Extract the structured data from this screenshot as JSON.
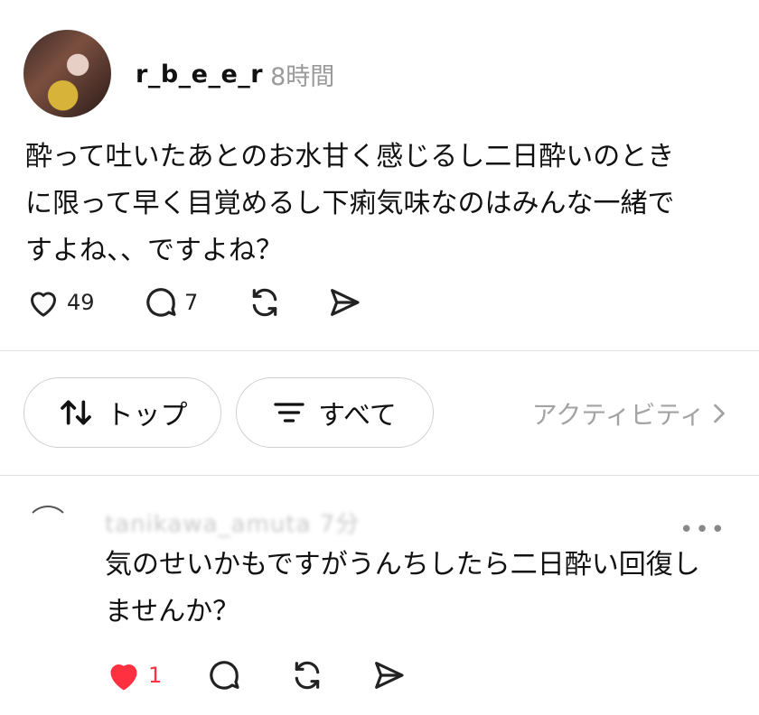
{
  "post": {
    "username": "r_b_e_e_r",
    "time": "8時間",
    "body_lines": [
      "酔って吐いたあとのお水甘く感じるし二日酔いのとき",
      "に限って早く目覚めるし下痢気味なのはみんな一緒で",
      "すよね、、ですよね？"
    ],
    "likes": "49",
    "comments": "7"
  },
  "filters": {
    "top_label": "トップ",
    "all_label": "すべて",
    "activity_label": "アクティビティ"
  },
  "reply": {
    "username": "tanikawa_amuta 7分",
    "body_lines": [
      "気のせいかもですがうんちしたら二日酔い回復し",
      "ませんか？"
    ],
    "likes": "1"
  },
  "colors": {
    "like_red": "#ff3040",
    "muted": "#9a9a9a"
  },
  "icons": [
    "heart-icon",
    "comment-icon",
    "repost-icon",
    "share-icon",
    "sort-arrows-icon",
    "filter-lines-icon",
    "chevron-right-icon",
    "more-icon"
  ]
}
